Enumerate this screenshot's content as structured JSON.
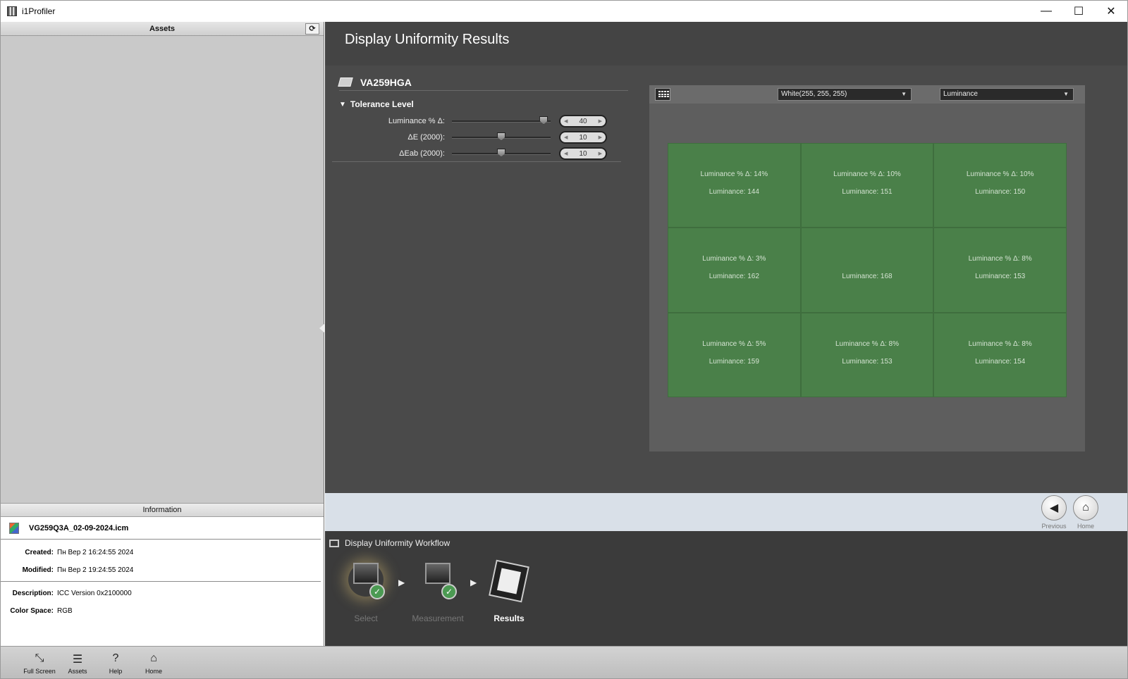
{
  "app": {
    "title": "i1Profiler"
  },
  "window_controls": {
    "minimize": "—",
    "maximize": "☐",
    "close": "✕"
  },
  "left": {
    "assets_header": "Assets",
    "refresh_icon": "⟳",
    "info_header": "Information",
    "file_name": "VG259Q3A_02-09-2024.icm",
    "created_label": "Created:",
    "created_value": "Пн Вер 2 16:24:55 2024",
    "modified_label": "Modified:",
    "modified_value": "Пн Вер 2 19:24:55 2024",
    "description_label": "Description:",
    "description_value": "ICC Version 0x2100000",
    "colorspace_label": "Color Space:",
    "colorspace_value": "RGB"
  },
  "main": {
    "title": "Display Uniformity Results",
    "device_name": "VA259HGA",
    "tolerance_label": "Tolerance Level",
    "sliders": [
      {
        "label": "Luminance % Δ:",
        "value": "40",
        "position": 0.93
      },
      {
        "label": "ΔE (2000):",
        "value": "10",
        "position": 0.5
      },
      {
        "label": "ΔEab (2000):",
        "value": "10",
        "position": 0.5
      }
    ],
    "color_select": "White(255, 255, 255)",
    "mode_select": "Luminance",
    "cells": [
      {
        "delta": "Luminance % Δ:  14%",
        "lum": "Luminance:  144"
      },
      {
        "delta": "Luminance % Δ:  10%",
        "lum": "Luminance:  151"
      },
      {
        "delta": "Luminance % Δ:  10%",
        "lum": "Luminance:  150"
      },
      {
        "delta": "Luminance % Δ:  3%",
        "lum": "Luminance:  162"
      },
      {
        "delta": "",
        "lum": "Luminance:  168"
      },
      {
        "delta": "Luminance % Δ:  8%",
        "lum": "Luminance:  153"
      },
      {
        "delta": "Luminance % Δ:  5%",
        "lum": "Luminance:  159"
      },
      {
        "delta": "Luminance % Δ:  8%",
        "lum": "Luminance:  153"
      },
      {
        "delta": "Luminance % Δ:  8%",
        "lum": "Luminance:  154"
      }
    ],
    "previous_label": "Previous",
    "home_label": "Home"
  },
  "workflow": {
    "title": "Display Uniformity Workflow",
    "steps": [
      "Select",
      "Measurement",
      "Results"
    ]
  },
  "toolbar": {
    "fullscreen": "Full Screen",
    "assets": "Assets",
    "help": "Help",
    "home": "Home"
  },
  "colors": {
    "cell_green": "#4a8049",
    "panel_dark": "#4a4a4a"
  }
}
